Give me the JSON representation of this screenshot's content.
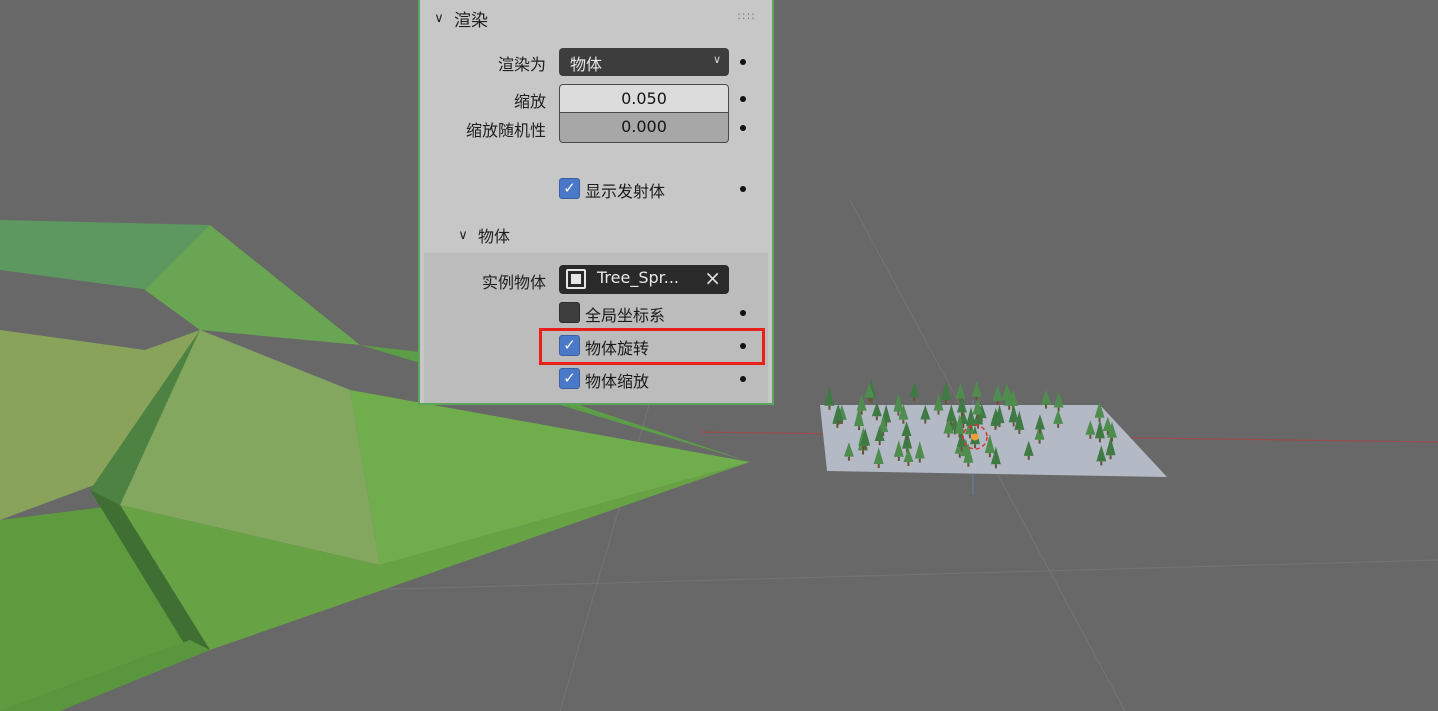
{
  "panel": {
    "section_title": "渲染",
    "render_as": {
      "label": "渲染为",
      "value": "物体"
    },
    "scale": {
      "label": "缩放",
      "value": "0.050"
    },
    "scale_random": {
      "label": "缩放随机性",
      "value": "0.000"
    },
    "show_emitter": {
      "label": "显示发射体",
      "checked": true
    },
    "object_section": {
      "title": "物体",
      "instance_object": {
        "label": "实例物体",
        "value": "Tree_Spr..."
      },
      "global_coordinates": {
        "label": "全局坐标系",
        "checked": false
      },
      "object_rotation": {
        "label": "物体旋转",
        "checked": true
      },
      "object_scale": {
        "label": "物体缩放",
        "checked": true
      }
    }
  },
  "colors": {
    "viewport_bg": "#686868",
    "panel_bg": "#c7c7c7",
    "panel_border": "#5ba65a",
    "checkbox": "#4b79c9",
    "highlight": "#e8201a"
  }
}
